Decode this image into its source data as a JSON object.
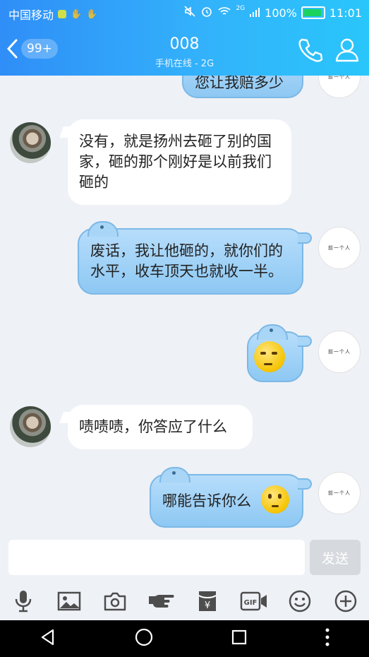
{
  "status_bar": {
    "carrier": "中国移动",
    "network": "2G",
    "battery": "100%",
    "time": "11:01"
  },
  "header": {
    "unread_badge": "99+",
    "title": "008",
    "subtitle": "手机在线 - 2G"
  },
  "messages": [
    {
      "side": "me",
      "text": "您让我赔多少"
    },
    {
      "side": "other",
      "text": "没有，就是扬州去砸了别的国家，砸的那个刚好是以前我们砸的"
    },
    {
      "side": "me",
      "text": "废话，我让他砸的，就你们的水平，收车顶天也就收一半。"
    },
    {
      "side": "me",
      "text": ""
    },
    {
      "side": "other",
      "text": "啧啧啧，你答应了什么"
    },
    {
      "side": "me",
      "text": "哪能告诉你么"
    }
  ],
  "my_avatar_text": "前一个人",
  "composer": {
    "placeholder": "",
    "send_label": "发送"
  },
  "toolbar_icons": [
    "microphone-icon",
    "image-icon",
    "camera-icon",
    "hand-point-icon",
    "red-packet-icon",
    "gif-icon",
    "emoji-icon",
    "plus-icon"
  ],
  "colors": {
    "header_start": "#2f8ef7",
    "header_end": "#29c6fb",
    "bubble_blue": "#a9d5f7",
    "background": "#eef1f6"
  }
}
